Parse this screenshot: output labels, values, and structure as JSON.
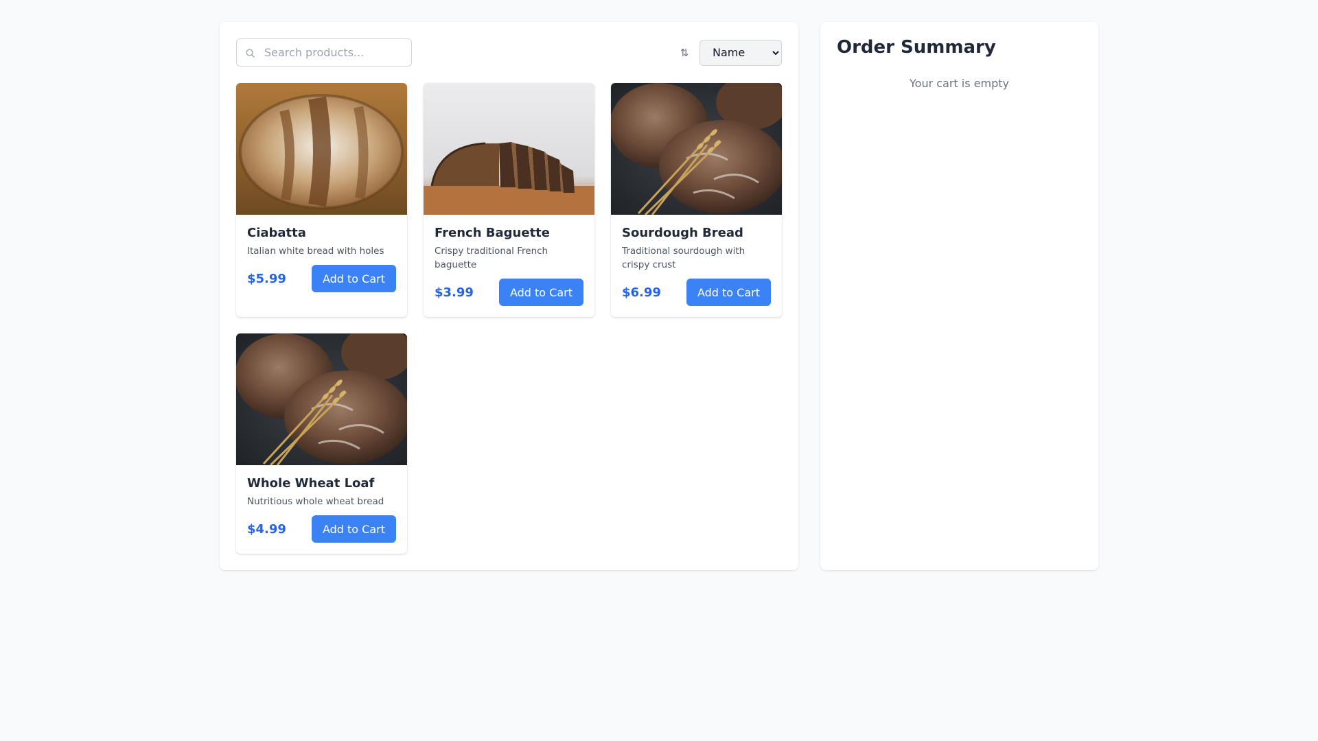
{
  "search": {
    "placeholder": "Search products..."
  },
  "sort": {
    "selected": "Name",
    "options": [
      "Name"
    ]
  },
  "products": [
    {
      "name": "Ciabatta",
      "description": "Italian white bread with holes",
      "price": "$5.99",
      "button": "Add to Cart",
      "image": "round-loaf-photo"
    },
    {
      "name": "French Baguette",
      "description": "Crispy traditional French baguette",
      "price": "$3.99",
      "button": "Add to Cart",
      "image": "sliced-loaf-photo"
    },
    {
      "name": "Sourdough Bread",
      "description": "Traditional sourdough with crispy crust",
      "price": "$6.99",
      "button": "Add to Cart",
      "image": "rye-loaves-wheat-photo"
    },
    {
      "name": "Whole Wheat Loaf",
      "description": "Nutritious whole wheat bread",
      "price": "$4.99",
      "button": "Add to Cart",
      "image": "rye-loaves-wheat-photo"
    }
  ],
  "summary": {
    "title": "Order Summary",
    "empty_message": "Your cart is empty"
  },
  "colors": {
    "accent": "#3b82f6",
    "price": "#2563eb",
    "background": "#f9fafb"
  }
}
